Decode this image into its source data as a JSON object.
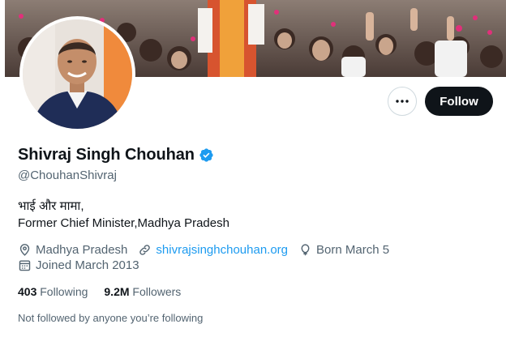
{
  "profile": {
    "name": "Shivraj Singh Chouhan",
    "handle": "@ChouhanShivraj",
    "verified": true,
    "verified_color": "#1d9bf0",
    "bio_lines": [
      "भाई और मामा,",
      "Former Chief Minister,Madhya Pradesh"
    ],
    "location": "Madhya Pradesh",
    "website": "shivrajsinghchouhan.org",
    "birthday": "Born March 5",
    "joined": "Joined March 2013"
  },
  "actions": {
    "follow_label": "Follow",
    "more_icon": "more-horizontal-icon"
  },
  "stats": {
    "following_count": "403",
    "following_label": "Following",
    "followers_count": "9.2M",
    "followers_label": "Followers"
  },
  "footer": {
    "not_followed": "Not followed by anyone you’re following"
  },
  "icons": {
    "location": "location-pin-icon",
    "website": "link-icon",
    "birthday": "balloon-icon",
    "joined": "calendar-icon"
  },
  "colors": {
    "text_primary": "#0f1419",
    "text_secondary": "#536471",
    "link": "#1d9bf0",
    "follow_button_bg": "#0f1419"
  }
}
